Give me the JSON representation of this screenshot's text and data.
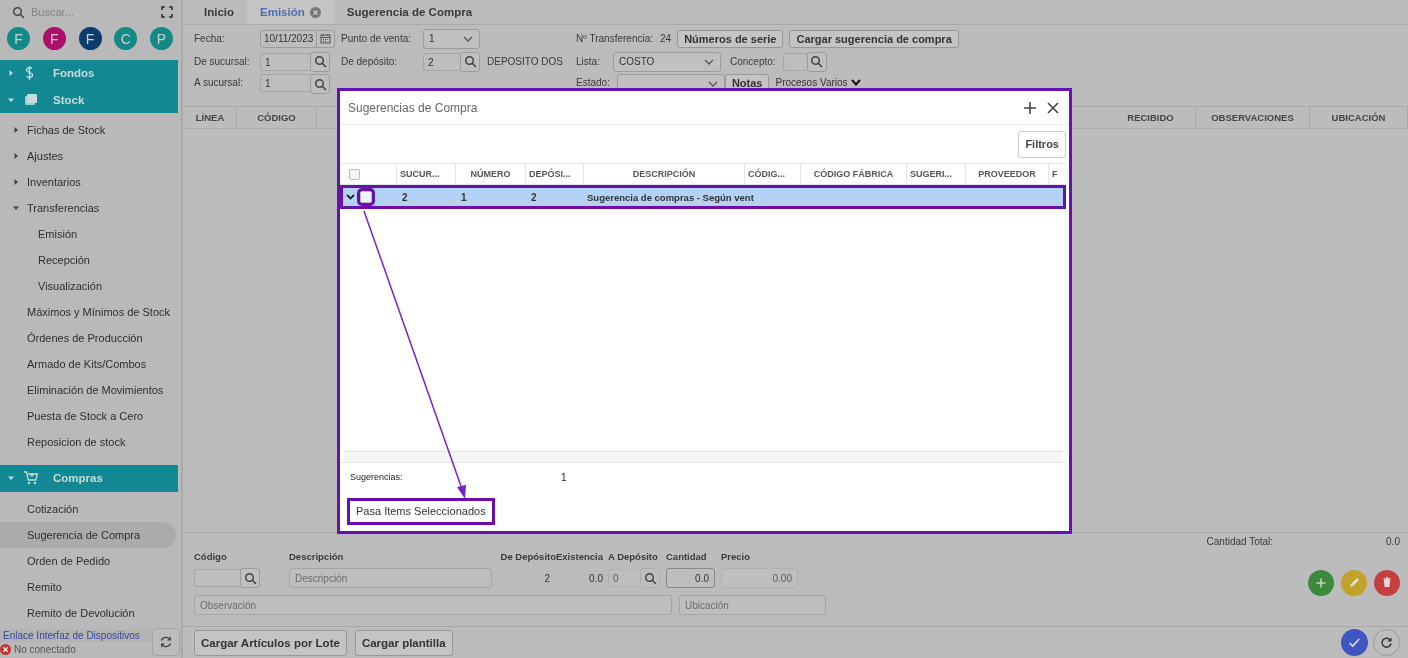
{
  "sidebar": {
    "search": {
      "placeholder": "Buscar..."
    },
    "avatars": [
      {
        "letter": "F",
        "color": "#138a86"
      },
      {
        "letter": "F",
        "color": "#a8106a"
      },
      {
        "letter": "F",
        "color": "#0c3c6e"
      },
      {
        "letter": "C",
        "color": "#138a86"
      },
      {
        "letter": "P",
        "color": "#138a86"
      }
    ],
    "menu": [
      {
        "label": "Fondos",
        "expanded": false
      },
      {
        "label": "Stock",
        "expanded": true,
        "children": [
          {
            "label": "Fichas de Stock",
            "expanded": false,
            "selected": false
          },
          {
            "label": "Ajustes",
            "expanded": false,
            "selected": false
          },
          {
            "label": "Inventarios",
            "expanded": false,
            "selected": false
          },
          {
            "label": "Transferencias",
            "expanded": true,
            "selected": false,
            "children": [
              {
                "label": "Emisión",
                "selected": false
              },
              {
                "label": "Recepción",
                "selected": false
              },
              {
                "label": "Visualización",
                "selected": false
              }
            ]
          },
          {
            "label": "Máximos y Mínimos de Stock",
            "selected": false
          },
          {
            "label": "Órdenes de Producción",
            "selected": false
          },
          {
            "label": "Armado de Kits/Combos",
            "selected": false
          },
          {
            "label": "Eliminación de Movimientos",
            "selected": false
          },
          {
            "label": "Puesta de Stock a Cero",
            "selected": false
          },
          {
            "label": "Reposicion de stock",
            "selected": false
          }
        ]
      },
      {
        "label": "Compras",
        "expanded": true,
        "children": [
          {
            "label": "Cotización",
            "selected": false
          },
          {
            "label": "Sugerencia de Compra",
            "selected": true
          },
          {
            "label": "Orden de Pedido",
            "selected": false
          },
          {
            "label": "Remito",
            "selected": false
          },
          {
            "label": "Remito de Devolución",
            "selected": false
          }
        ]
      }
    ],
    "footer": {
      "link": "Enlace Interfaz de Dispositivos",
      "status": "No conectado"
    }
  },
  "tabs": [
    {
      "label": "Inicio",
      "selected": false,
      "closable": false
    },
    {
      "label": "Emisión",
      "selected": true,
      "closable": true
    },
    {
      "label": "Sugerencia de Compra",
      "selected": false,
      "closable": false
    }
  ],
  "form": {
    "rows": [
      [
        [
          {
            "kind": "label",
            "text": "Fecha:"
          },
          {
            "kind": "date",
            "value": "10/11/2023"
          }
        ],
        [
          {
            "kind": "label",
            "text": "Punto de venta:"
          },
          {
            "kind": "select",
            "value": "1"
          }
        ],
        [
          {
            "kind": "label",
            "text": "Nº Transferencia:"
          },
          {
            "kind": "text",
            "text": "24"
          },
          {
            "kind": "button",
            "label": "Números de serie"
          },
          {
            "kind": "button",
            "label": "Cargar sugerencia de compra"
          }
        ]
      ],
      [
        [
          {
            "kind": "label",
            "text": "De sucursal:"
          },
          {
            "kind": "search",
            "value": "1"
          }
        ],
        [
          {
            "kind": "label",
            "text": "De depósito:"
          },
          {
            "kind": "search",
            "value": "2"
          },
          {
            "kind": "text",
            "text": "DEPOSITO DOS"
          }
        ],
        [
          {
            "kind": "label",
            "text": "Lista:"
          },
          {
            "kind": "select",
            "value": "COSTO"
          },
          {
            "kind": "label",
            "text": "Concepto:"
          },
          {
            "kind": "search"
          }
        ]
      ],
      [
        [
          {
            "kind": "label",
            "text": "A sucursal:"
          },
          {
            "kind": "search",
            "value": "1"
          }
        ],
        [],
        [
          {
            "kind": "label",
            "text": "Estado:"
          },
          {
            "kind": "select"
          },
          {
            "kind": "button",
            "label": "Notas"
          },
          {
            "kind": "menu",
            "label": "Procesos Varios"
          }
        ]
      ]
    ]
  },
  "main_table": {
    "columns": [
      "LÍNEA",
      "CÓDIGO",
      "RECIBIDO",
      "OBSERVACIONES",
      "UBICACIÓN"
    ]
  },
  "totals": {
    "label": "Cantidad Total:",
    "value": "0.0"
  },
  "item_form": {
    "fields": [
      {
        "label": "Código",
        "kind": "search"
      },
      {
        "label": "Descripción",
        "kind": "input",
        "placeholder": "Descripción"
      },
      {
        "label": "De Depósito",
        "kind": "readout",
        "value": "2"
      },
      {
        "label": "Existencia",
        "kind": "readout",
        "value": "0.0"
      },
      {
        "label": "A Depósito",
        "kind": "search",
        "value": "0",
        "disabled": true
      },
      {
        "label": "Cantidad",
        "kind": "input",
        "value": "0.0"
      },
      {
        "label": "Precio",
        "kind": "input",
        "value": "0.00",
        "disabled": true
      }
    ],
    "notes": [
      {
        "placeholder": "Observación"
      },
      {
        "placeholder": "Ubicación"
      }
    ]
  },
  "bottom_buttons": [
    "Cargar Artículos por Lote",
    "Cargar plantilla"
  ],
  "modal": {
    "title": "Sugerencias de Compra",
    "filter_button": "Filtros",
    "all_checked": false,
    "columns": [
      "SUCUR...",
      "NÚMERO",
      "DEPÓSI...",
      "DESCRIPCIÓN",
      "CÓDIG...",
      "CÓDIGO FÁBRICA",
      "SUGERI...",
      "PROVEEDOR",
      "F"
    ],
    "rows": [
      {
        "selected": true,
        "checked": false,
        "highlighted": true,
        "checkbox_highlighted": true,
        "cells": [
          "2",
          "1",
          "2",
          "Sugerencia de compras - Según vent"
        ]
      }
    ],
    "summary": {
      "label": "Sugerencias:",
      "value": "1"
    },
    "action_button": {
      "label": "Pasa Items Seleccionados",
      "highlighted": true
    }
  }
}
